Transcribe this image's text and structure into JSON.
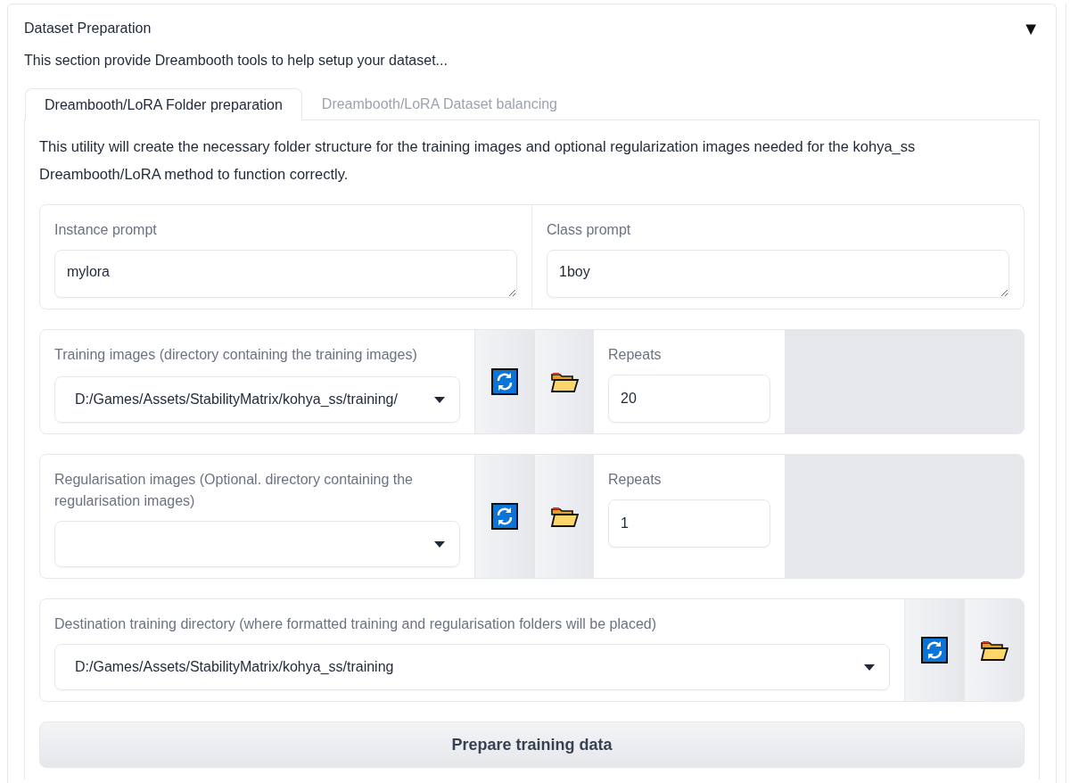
{
  "section": {
    "title": "Dataset Preparation",
    "toggle": "▼",
    "expanded": true,
    "description": "This section provide Dreambooth tools to help setup your dataset..."
  },
  "tabs": [
    {
      "label": "Dreambooth/LoRA Folder preparation",
      "selected": true
    },
    {
      "label": "Dreambooth/LoRA Dataset balancing",
      "selected": false
    }
  ],
  "intro": "This utility will create the necessary folder structure for the training images and optional regularization images needed for the kohya_ss Dreambooth/LoRA method to function correctly.",
  "prompts": [
    {
      "label": "Instance prompt",
      "value": "mylora"
    },
    {
      "label": "Class prompt",
      "value": "1boy"
    }
  ],
  "directories": [
    {
      "label": "Training images (directory containing the training images)",
      "value": "D:/Games/Assets/StabilityMatrix/kohya_ss/training/",
      "repeats": {
        "label": "Repeats",
        "value": "20"
      }
    },
    {
      "label": "Regularisation images (Optional. directory containing the regularisation images)",
      "repeats": {
        "label": "Repeats",
        "value": "1"
      }
    },
    {
      "label": "Destination training directory (where formatted training and regularisation folders will be placed)",
      "value": "D:/Games/Assets/StabilityMatrix/kohya_ss/training"
    }
  ],
  "button": "Prepare training data"
}
